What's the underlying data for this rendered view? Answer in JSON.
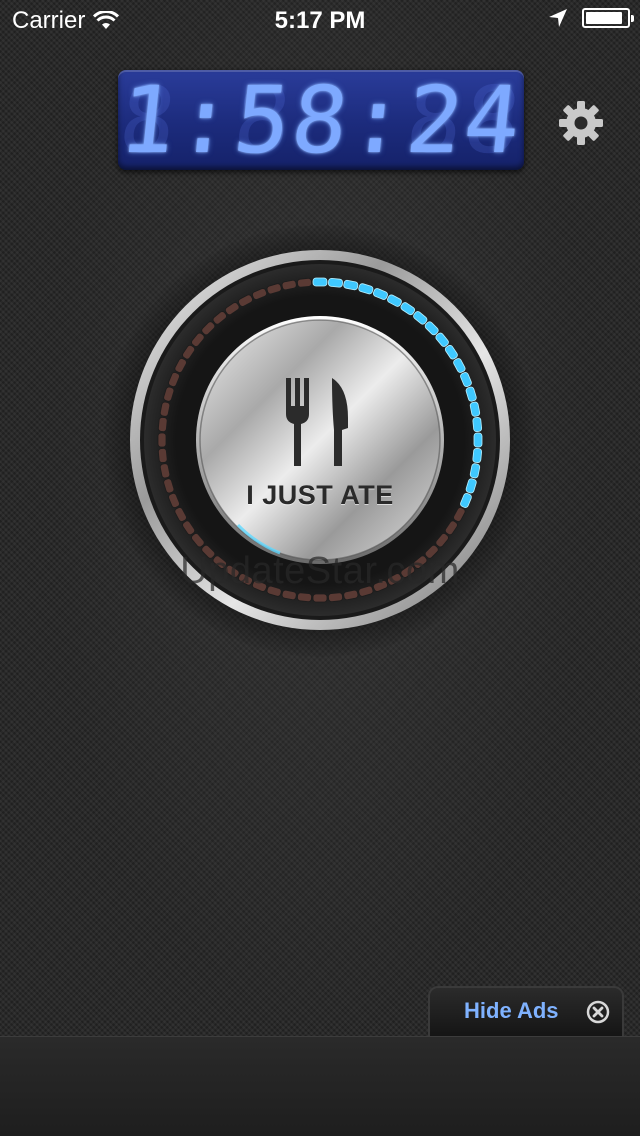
{
  "status_bar": {
    "carrier": "Carrier",
    "time": "5:17 PM",
    "battery_level": 0.9
  },
  "timer": {
    "display": "1:58:24",
    "ghost": "8:88:88",
    "color": "#7ea9ff"
  },
  "settings": {
    "icon": "gear-icon"
  },
  "dial": {
    "button_label": "I JUST ATE",
    "icon": "fork-knife-icon",
    "progress": 0.33,
    "led_active_color": "#3fc8ff",
    "led_inactive_color": "#5a3a34"
  },
  "watermark": "UpdateStar.com",
  "ads": {
    "hide_label": "Hide Ads",
    "close_icon": "close-icon"
  }
}
